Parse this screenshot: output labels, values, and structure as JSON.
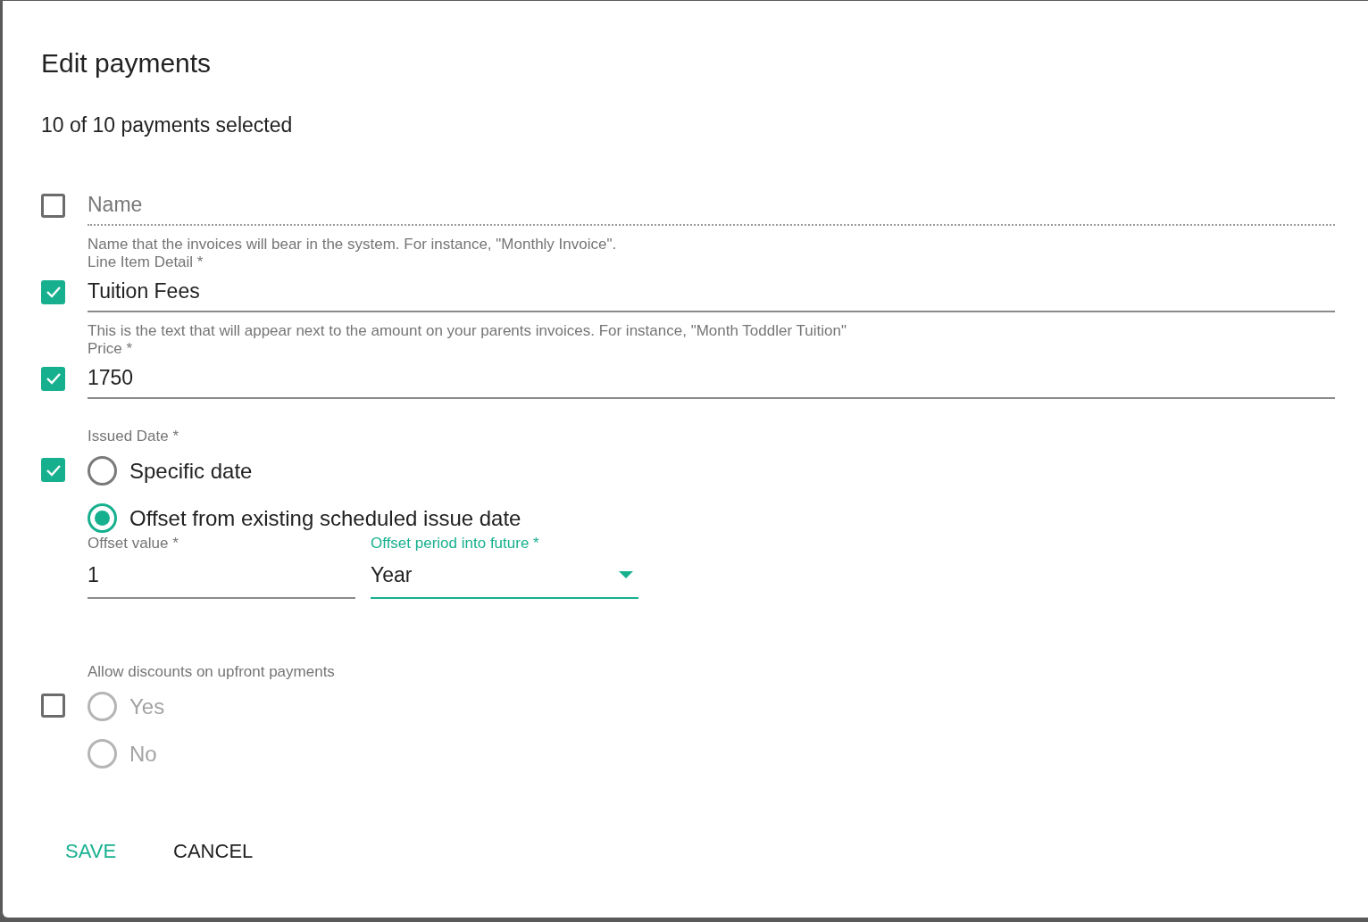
{
  "dialog": {
    "title": "Edit payments",
    "subtitle": "10 of 10 payments selected"
  },
  "fields": [
    {
      "kind": "text",
      "checked": false,
      "disabled": true,
      "placeholder": "Name",
      "helper": "Name that the invoices will bear in the system. For instance, \"Monthly Invoice\"."
    },
    {
      "kind": "text",
      "checked": true,
      "disabled": false,
      "label": "Line Item Detail *",
      "value": "Tuition Fees",
      "helper": "This is the text that will appear next to the amount on your parents invoices. For instance, \"Month Toddler Tuition\""
    },
    {
      "kind": "text",
      "checked": true,
      "disabled": false,
      "label": "Price *",
      "value": "1750"
    },
    {
      "kind": "radio",
      "checked": true,
      "disabled": false,
      "label": "Issued Date *",
      "options": [
        {
          "label": "Specific date",
          "selected": false
        },
        {
          "label": "Offset from existing scheduled issue date",
          "selected": true
        }
      ],
      "subfields": [
        {
          "kind": "input",
          "label": "Offset value *",
          "value": "1",
          "focused": false
        },
        {
          "kind": "select",
          "label": "Offset period into future *",
          "value": "Year",
          "focused": true
        }
      ]
    },
    {
      "kind": "radio",
      "checked": false,
      "disabled": true,
      "label": "Allow discounts on upfront payments",
      "options": [
        {
          "label": "Yes",
          "selected": false
        },
        {
          "label": "No",
          "selected": false
        }
      ]
    }
  ],
  "buttons": [
    {
      "label": "SAVE",
      "primary": true
    },
    {
      "label": "CANCEL",
      "primary": false
    }
  ]
}
